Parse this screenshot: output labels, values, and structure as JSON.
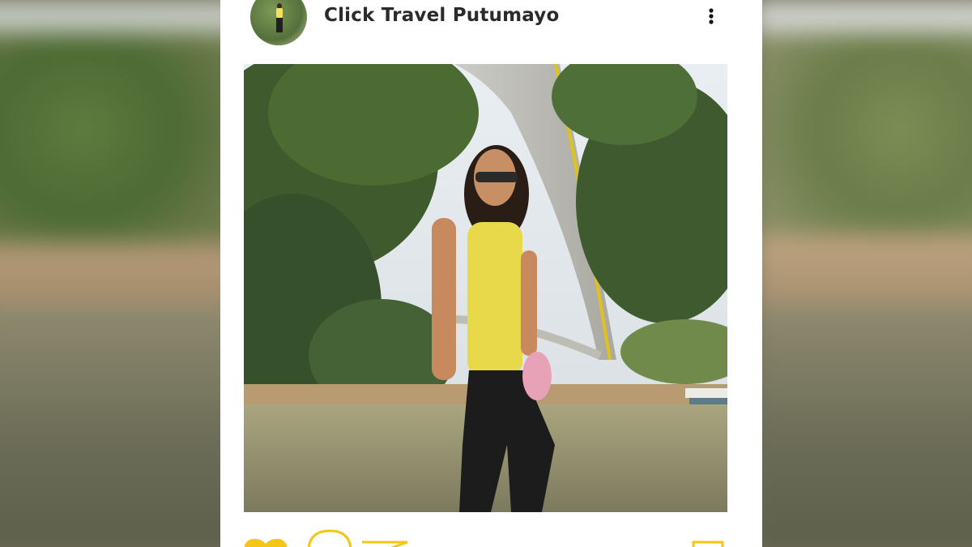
{
  "post": {
    "account_name": "Click Travel Putumayo",
    "avatar_icon": "profile-photo",
    "photo_description_icon": "post-photo"
  },
  "toolbar": {
    "more_icon": "more-vertical-icon",
    "like_icon": "heart-icon",
    "comment_icon": "comment-icon",
    "share_icon": "send-icon",
    "save_icon": "bookmark-icon"
  },
  "colors": {
    "accent": "#f5c518",
    "text": "#2b2b2b",
    "card": "#ffffff"
  }
}
